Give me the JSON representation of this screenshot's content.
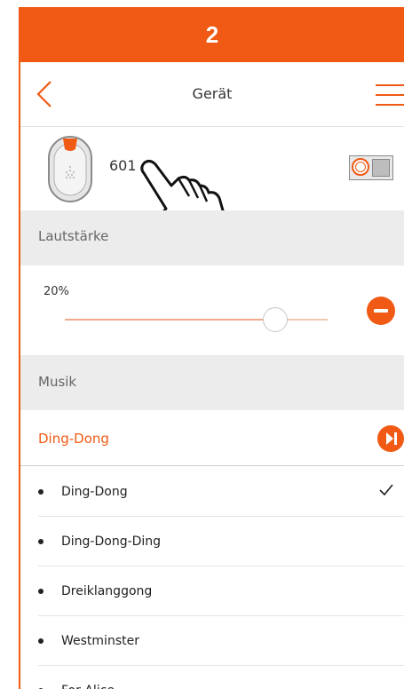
{
  "step": {
    "number": "2"
  },
  "nav": {
    "title": "Gerät"
  },
  "device": {
    "name": "601"
  },
  "volume": {
    "section_label": "Lautstärke",
    "percent_text": "20%",
    "slider_level": 0.8
  },
  "music": {
    "section_label": "Musik",
    "selected": "Ding-Dong",
    "items": [
      {
        "label": "Ding-Dong",
        "checked": true
      },
      {
        "label": "Ding-Dong-Ding",
        "checked": false
      },
      {
        "label": "Dreiklanggong",
        "checked": false
      },
      {
        "label": "Westminster",
        "checked": false
      },
      {
        "label": "For Alice",
        "checked": false
      }
    ]
  },
  "colors": {
    "accent": "#f05a14",
    "section_bg": "#ececec"
  },
  "icons": {
    "back": "chevron-left-icon",
    "menu": "hamburger-icon",
    "minus": "minus-circle-icon",
    "play": "play-skip-icon",
    "check": "checkmark-icon",
    "hand": "hand-pointer-icon"
  }
}
